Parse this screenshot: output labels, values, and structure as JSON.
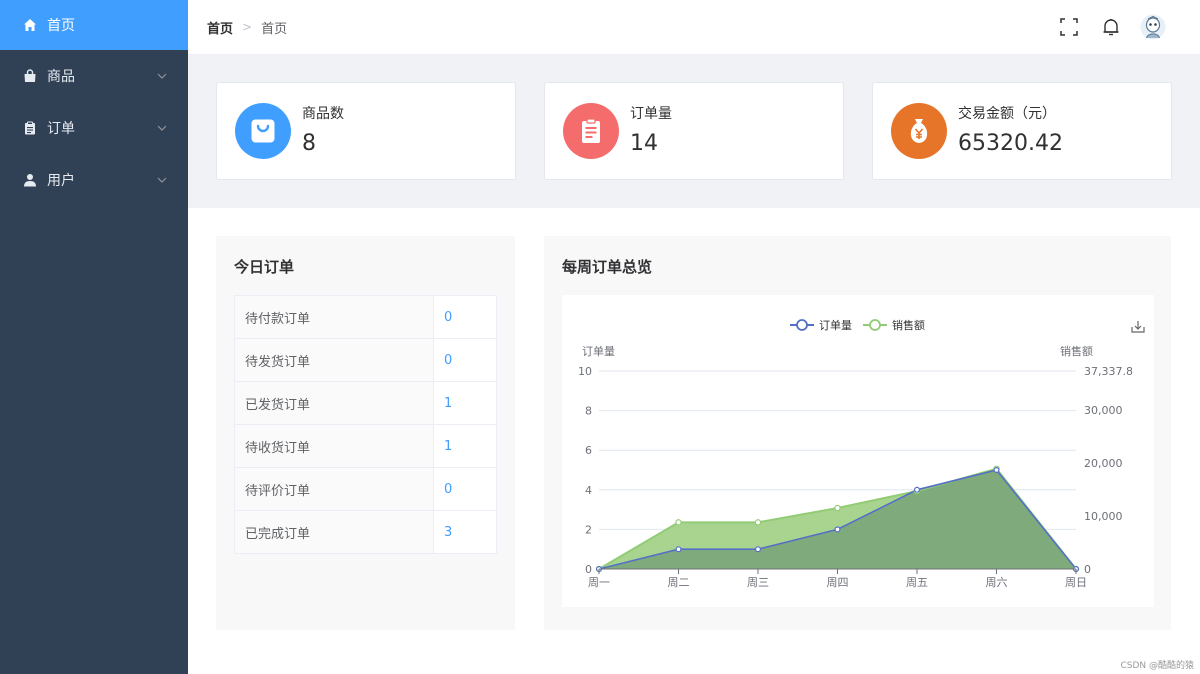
{
  "sidebar": {
    "items": [
      {
        "label": "首页",
        "icon": "home-icon",
        "active": true
      },
      {
        "label": "商品",
        "icon": "shopping-bag-icon",
        "expandable": true
      },
      {
        "label": "订单",
        "icon": "clipboard-icon",
        "expandable": true
      },
      {
        "label": "用户",
        "icon": "user-icon",
        "expandable": true
      }
    ]
  },
  "header": {
    "breadcrumb": [
      "首页",
      "首页"
    ],
    "separator": ">",
    "icons": [
      "fullscreen-icon",
      "bell-icon",
      "avatar"
    ]
  },
  "stats": [
    {
      "label": "商品数",
      "value": "8",
      "color": "#409eff",
      "icon": "shopping-bag-icon"
    },
    {
      "label": "订单量",
      "value": "14",
      "color": "#f56c6c",
      "icon": "clipboard-icon"
    },
    {
      "label": "交易金额（元）",
      "value": "65320.42",
      "color": "#e6752a",
      "icon": "money-bag-icon"
    }
  ],
  "today": {
    "title": "今日订单",
    "rows": [
      {
        "label": "待付款订单",
        "value": "0"
      },
      {
        "label": "待发货订单",
        "value": "0"
      },
      {
        "label": "已发货订单",
        "value": "1"
      },
      {
        "label": "待收货订单",
        "value": "1"
      },
      {
        "label": "待评价订单",
        "value": "0"
      },
      {
        "label": "已完成订单",
        "value": "3"
      }
    ]
  },
  "weekly": {
    "title": "每周订单总览",
    "chart_data": {
      "type": "line",
      "categories": [
        "周一",
        "周二",
        "周三",
        "周四",
        "周五",
        "周六",
        "周日"
      ],
      "y_left": {
        "label": "订单量",
        "min": 0,
        "max": 10,
        "ticks": [
          "0",
          "2",
          "4",
          "6",
          "8",
          "10"
        ]
      },
      "y_right": {
        "label": "销售额",
        "min": 0,
        "max": 37337.8,
        "ticks": [
          "0",
          "10,000",
          "20,000",
          "30,000",
          "37,337.8"
        ]
      },
      "series": [
        {
          "name": "订单量",
          "axis": "left",
          "color": "#5470c6",
          "area_color": "#7eaa7c",
          "values": [
            0,
            1,
            1,
            2,
            4,
            5,
            0
          ]
        },
        {
          "name": "销售额",
          "axis": "right",
          "color": "#91cc75",
          "area_color": "#a9d48f",
          "values": [
            0,
            8800,
            8800,
            11500,
            14700,
            18900,
            0
          ]
        }
      ],
      "legend": "top-center",
      "grid": true
    },
    "toolbox_icon": "download-icon"
  },
  "watermark": "CSDN @酷酷的猿"
}
